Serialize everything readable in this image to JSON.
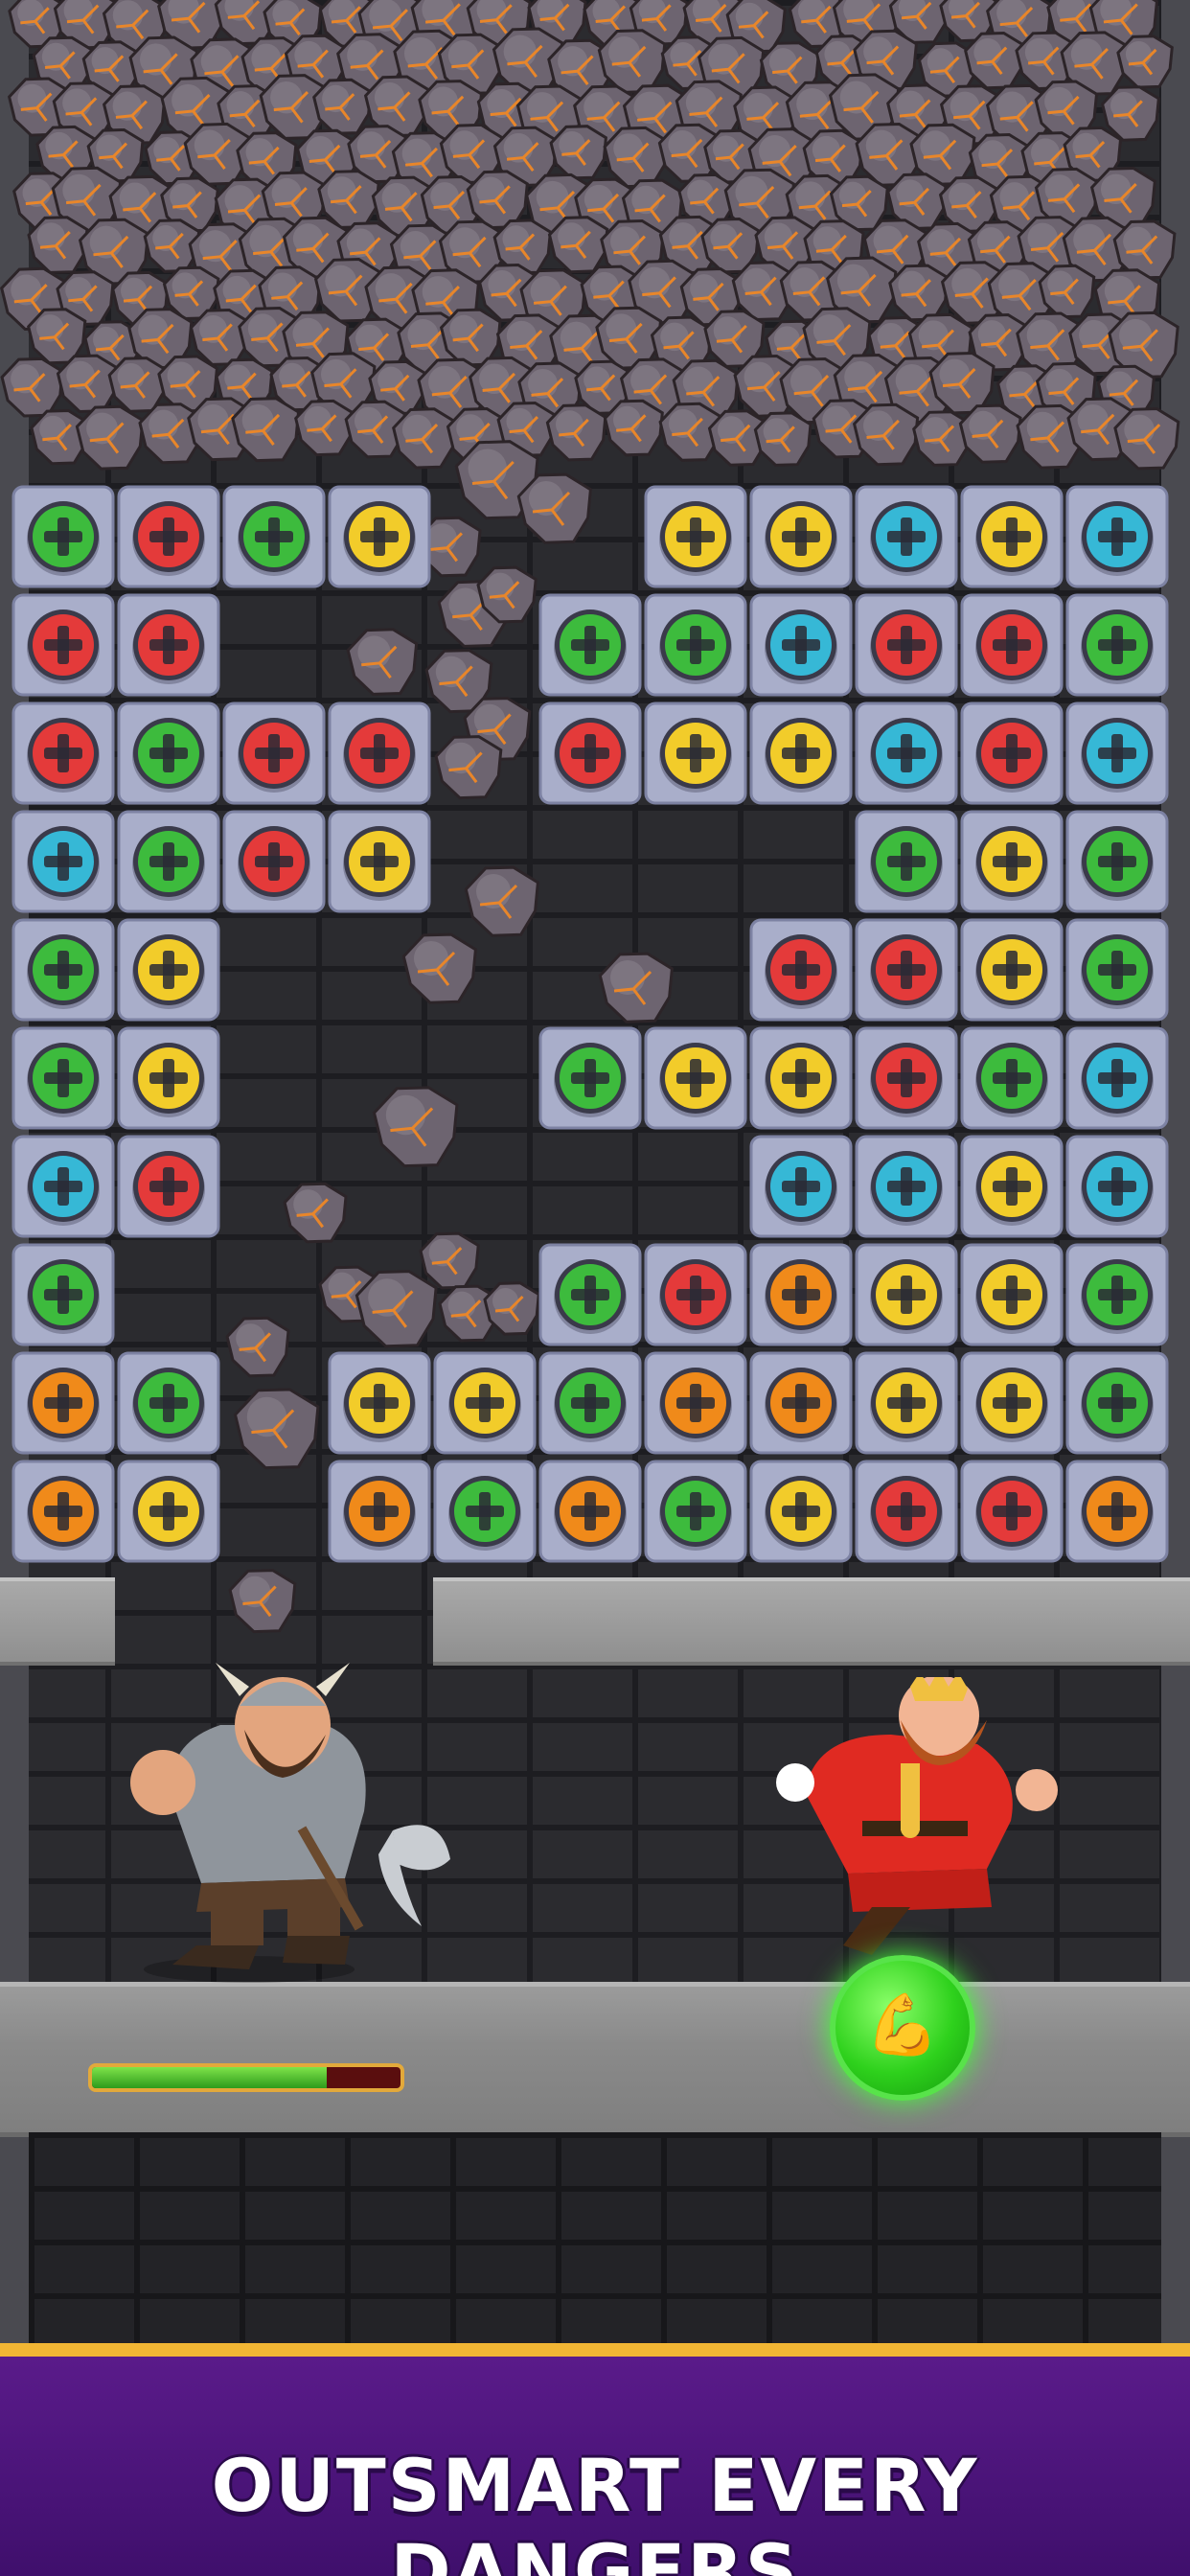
{
  "colors": {
    "red": "#e43a3a",
    "green": "#3dbb3d",
    "yellow": "#f2cc2a",
    "blue": "#36b8d6",
    "orange": "#f08a1a",
    "tile": "#a9aeca",
    "banner": "#4a1478",
    "banner_border": "#f2b634"
  },
  "icons": {
    "rock": "lava-rock-icon",
    "pin": "plus-screw-icon",
    "power": "strength-arm-icon"
  },
  "board": {
    "rows": [
      [
        "green",
        "red",
        "green",
        "yellow",
        null,
        null,
        "yellow",
        "yellow",
        "blue",
        "yellow",
        "blue"
      ],
      [
        "red",
        "red",
        null,
        null,
        null,
        "green",
        "green",
        "blue",
        "red",
        "red",
        "green"
      ],
      [
        "red",
        "green",
        "red",
        "red",
        null,
        "red",
        "yellow",
        "yellow",
        "blue",
        "red",
        "blue"
      ],
      [
        "blue",
        "green",
        "red",
        "yellow",
        null,
        null,
        null,
        null,
        "green",
        "yellow",
        "green"
      ],
      [
        "green",
        "yellow",
        null,
        null,
        null,
        null,
        null,
        "red",
        "red",
        "yellow",
        "green"
      ],
      [
        "green",
        "yellow",
        null,
        null,
        null,
        "green",
        "yellow",
        "yellow",
        "red",
        "green",
        "blue"
      ],
      [
        "blue",
        "red",
        null,
        null,
        null,
        null,
        null,
        "blue",
        "blue",
        "yellow",
        "blue"
      ],
      [
        "green",
        null,
        null,
        null,
        null,
        "green",
        "red",
        "orange",
        "yellow",
        "yellow",
        "green"
      ],
      [
        "orange",
        "green",
        null,
        "yellow",
        "yellow",
        "green",
        "orange",
        "orange",
        "yellow",
        "yellow",
        "green"
      ],
      [
        "orange",
        "yellow",
        null,
        "orange",
        "green",
        "orange",
        "green",
        "yellow",
        "red",
        "red",
        "orange"
      ]
    ]
  },
  "hero": {
    "health_fraction": 0.76
  },
  "banner": {
    "text": "OUTSMART EVERY DANGERS"
  }
}
